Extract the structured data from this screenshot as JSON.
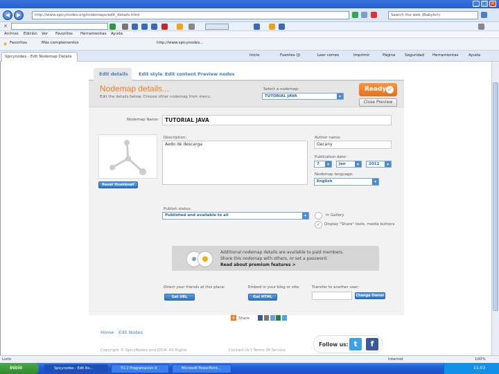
{
  "browser": {
    "address": "http://www.spicynodes.org/nodemaps/edit_details.html",
    "search_placeholder": "Search the web (Babylon)",
    "menu": [
      "Archivo",
      "Edición",
      "Ver",
      "Favoritos",
      "Herramientas",
      "Ayuda"
    ],
    "favorites_label": "Favoritos",
    "favorites_items": [
      "Más complementos",
      "",
      "http://www.spicynodes..."
    ],
    "tab_title": "Spicynodes - Edit Nodemap Details",
    "commands": [
      "Inicio",
      "Fuentes (J)",
      "Leer correo",
      "Imprimir",
      "Página",
      "Seguridad",
      "Herramientas",
      "Ayuda"
    ]
  },
  "page": {
    "tabs": [
      "Edit details",
      "Edit style",
      "Edit content",
      "Preview nodes"
    ],
    "title": "Nodemap details...",
    "subtitle": "Edit the details below. Choose other nodemap from menu.",
    "select_label": "Select a nodemap:",
    "select_value": "TUTORIAL JAVA",
    "ready_label": "Ready",
    "close_preview_label": "Close Preview",
    "nodemap_name_label": "Nodemap Name:",
    "nodemap_name_value": "TUTORIAL JAVA",
    "description_label": "Description:",
    "description_value": "Aedo de descarga",
    "author_label": "Author name:",
    "author_value": "Gecany",
    "pub_date_label": "Publication date:",
    "date_day": "7",
    "date_month": "Jan",
    "date_year": "2012",
    "language_label": "Nodemap language:",
    "language_value": "English",
    "thumbnail_button": "Reset thumbnail",
    "publish_label": "Publish status:",
    "publish_value": "Published and available to all",
    "gallery_label": "in Gallery",
    "display_label": "Display \"Share\" tools, media buttons",
    "premium_line1": "Additional nodemap details are available to paid members.",
    "premium_line2": "Share this nodemap with others, or set a password.",
    "premium_link": "Read about premium features >",
    "direct_link_label": "Direct your friends at this place:",
    "get_url": "Get URL",
    "embed_label": "Embed in your blog or site:",
    "get_html": "Get HTML",
    "transfer_label": "Transfer to another user:",
    "change_owner": "Change Owner",
    "share_label": "Share",
    "footer_links": [
      "Home",
      "Edit Nodes"
    ],
    "copyright": "Copyright © SpicyNodes and IDCA. All Rights",
    "contact": "Contact Us | Terms Of Service",
    "follow_us": "Follow us:"
  },
  "status": {
    "left": "Listo",
    "zone": "Internet",
    "zoom": "100%"
  },
  "taskbar": {
    "start": "Inicio",
    "items": [
      "Spicynodes - Edit No...",
      "TU 2 Programacion II",
      "Microsoft PowerPoint..."
    ],
    "clock": "11:03"
  }
}
